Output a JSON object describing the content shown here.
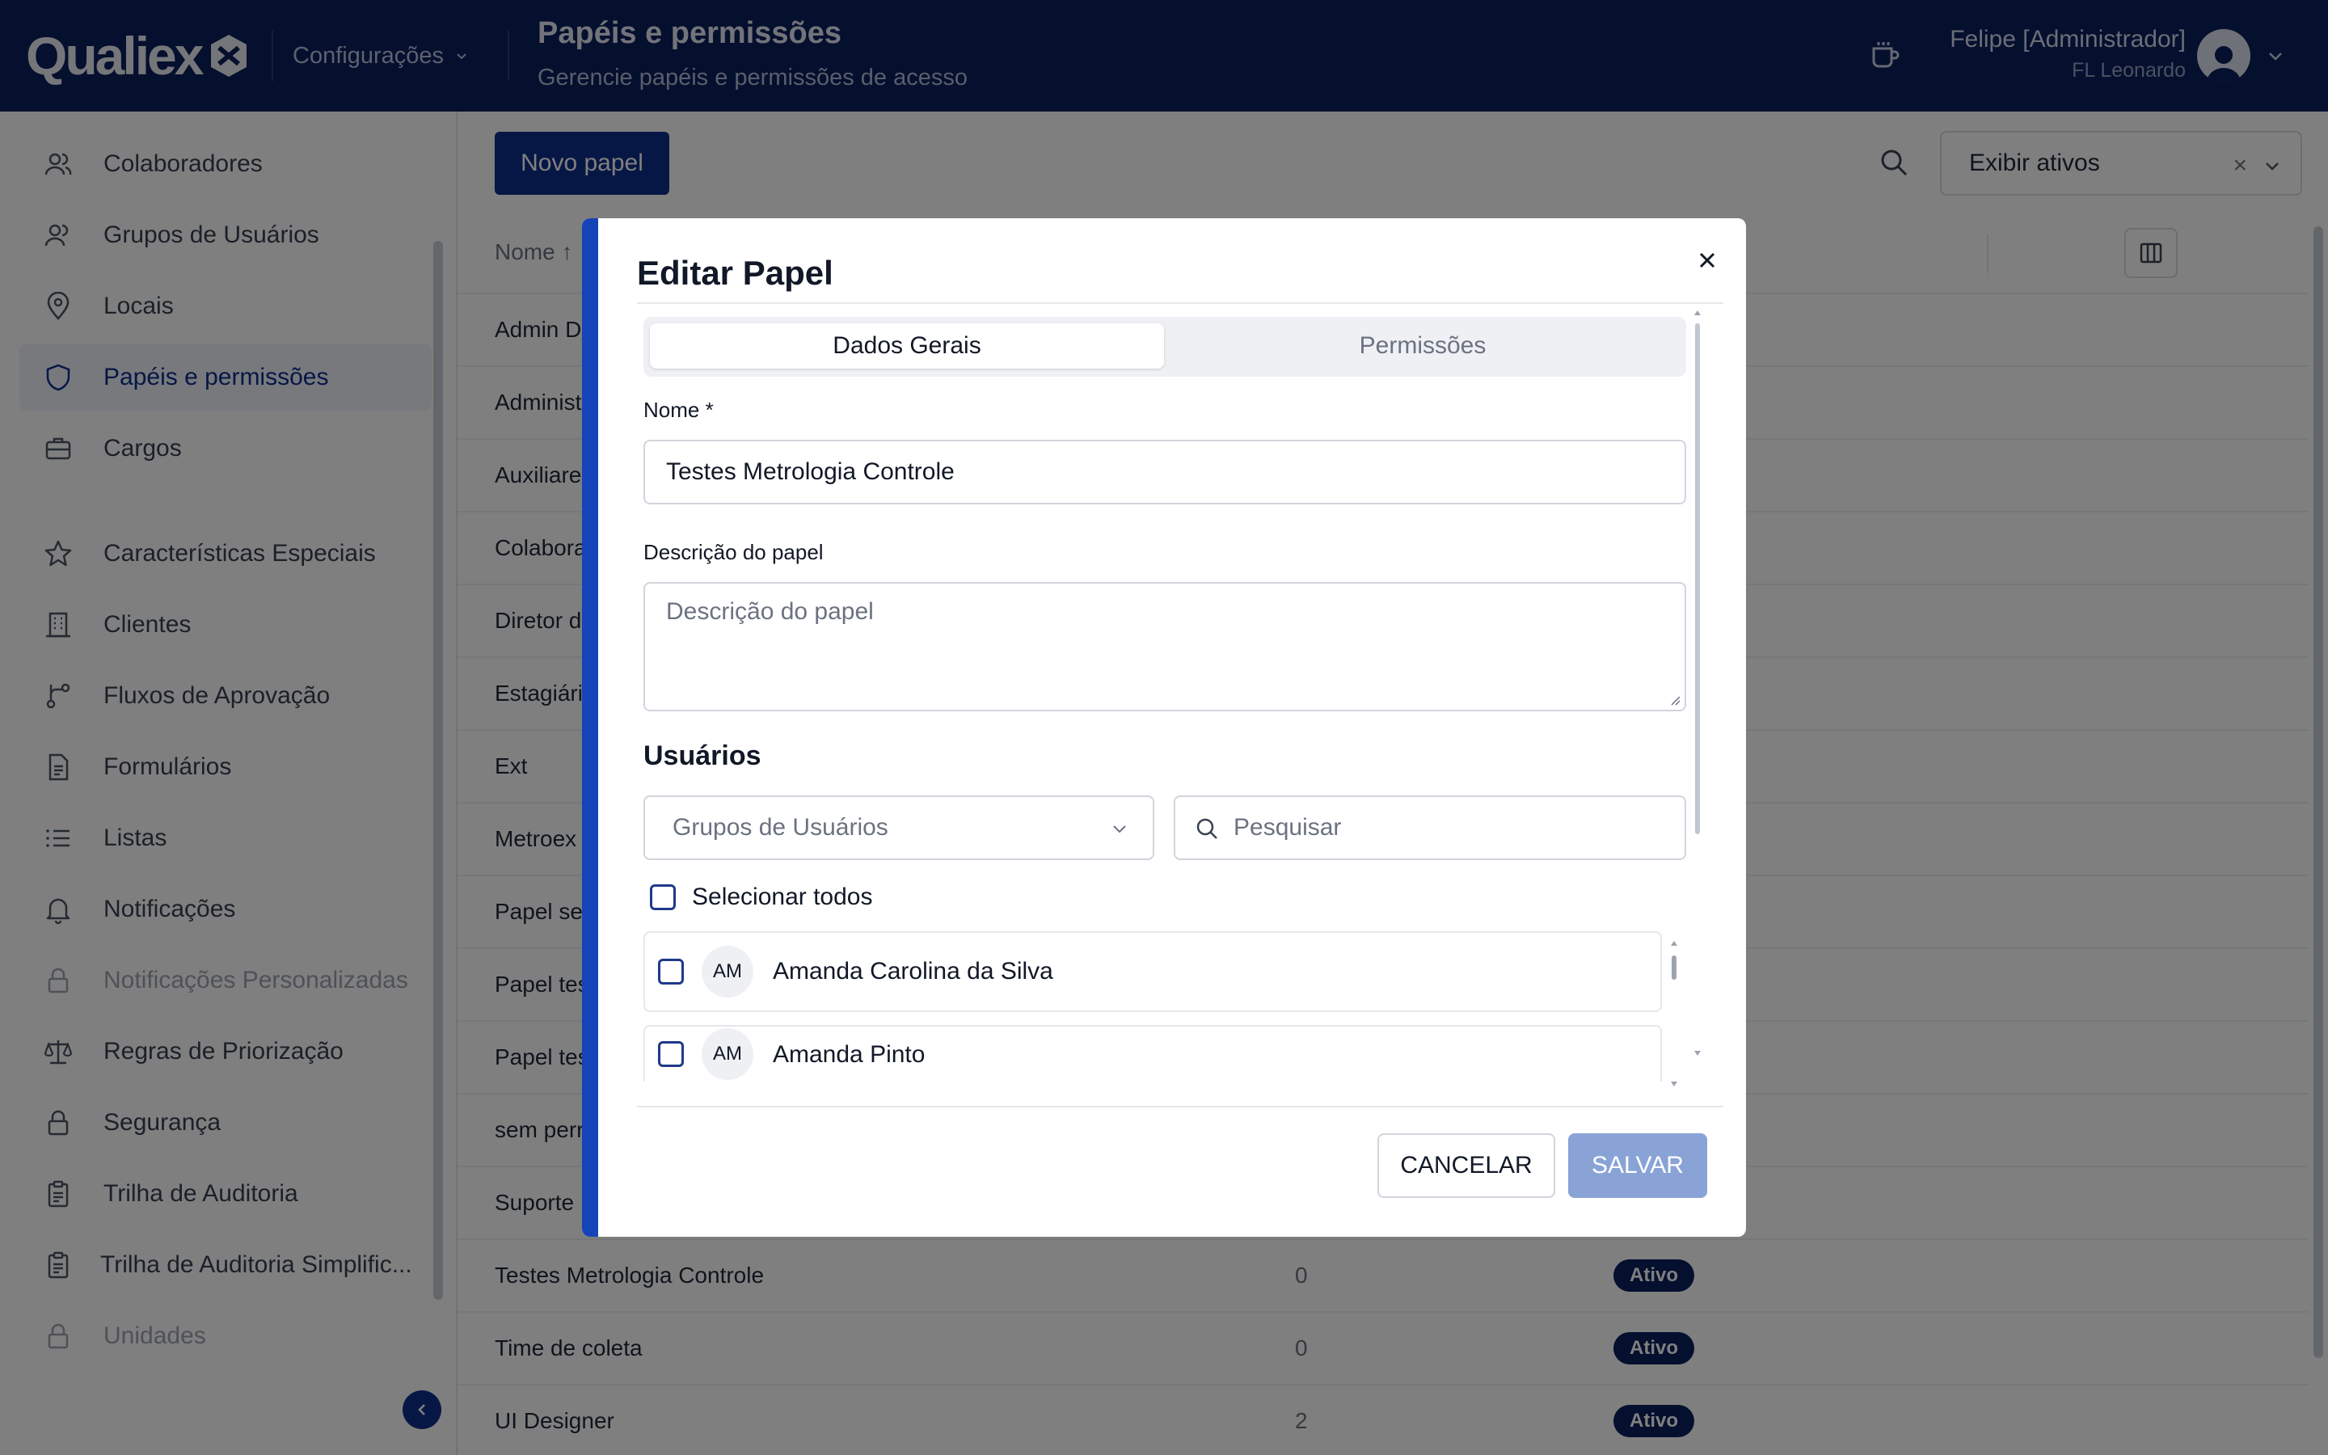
{
  "header": {
    "brand": "Qualiex",
    "module": "Configurações",
    "title": "Papéis e permissões",
    "subtitle": "Gerencie papéis e permissões de acesso",
    "user_name": "Felipe [Administrador]",
    "user_org": "FL Leonardo",
    "icons": [
      "coffee-cup-icon",
      "avatar-icon",
      "chevron-down-icon"
    ]
  },
  "sidebar": {
    "items": [
      {
        "label": "Colaboradores",
        "icon": "users-icon"
      },
      {
        "label": "Grupos de Usuários",
        "icon": "user-group-icon"
      },
      {
        "label": "Locais",
        "icon": "map-pin-icon"
      },
      {
        "label": "Papéis e permissões",
        "icon": "shield-icon",
        "active": true
      },
      {
        "label": "Cargos",
        "icon": "briefcase-icon"
      },
      {
        "label": "Características Especiais",
        "icon": "star-icon"
      },
      {
        "label": "Clientes",
        "icon": "building-icon"
      },
      {
        "label": "Fluxos de Aprovação",
        "icon": "flow-icon"
      },
      {
        "label": "Formulários",
        "icon": "document-icon"
      },
      {
        "label": "Listas",
        "icon": "list-icon"
      },
      {
        "label": "Notificações",
        "icon": "bell-icon"
      },
      {
        "label": "Notificações Personalizadas",
        "icon": "lock-icon",
        "disabled": true
      },
      {
        "label": "Regras de Priorização",
        "icon": "scale-icon"
      },
      {
        "label": "Segurança",
        "icon": "lock-icon"
      },
      {
        "label": "Trilha de Auditoria",
        "icon": "clipboard-icon"
      },
      {
        "label": "Trilha de Auditoria Simplific...",
        "icon": "clipboard-icon"
      },
      {
        "label": "Unidades",
        "icon": "lock-icon",
        "disabled": true
      }
    ]
  },
  "toolbar": {
    "new_button": "Novo papel",
    "filter_value": "Exibir ativos",
    "filter_clear": "×"
  },
  "table": {
    "header_name": "Nome ↑",
    "rows": [
      {
        "name": "Admin D",
        "count": "",
        "status": ""
      },
      {
        "name": "Administ",
        "count": "",
        "status": ""
      },
      {
        "name": "Auxiliare",
        "count": "",
        "status": ""
      },
      {
        "name": "Colabora",
        "count": "",
        "status": ""
      },
      {
        "name": "Diretor d",
        "count": "",
        "status": ""
      },
      {
        "name": "Estagiári",
        "count": "",
        "status": ""
      },
      {
        "name": "Ext",
        "count": "",
        "status": ""
      },
      {
        "name": "Metroex",
        "count": "",
        "status": ""
      },
      {
        "name": "Papel se",
        "count": "",
        "status": ""
      },
      {
        "name": "Papel tes",
        "count": "",
        "status": ""
      },
      {
        "name": "Papel tes",
        "count": "",
        "status": ""
      },
      {
        "name": "sem perr",
        "count": "",
        "status": ""
      },
      {
        "name": "Suporte",
        "count": "",
        "status": ""
      },
      {
        "name": "Testes Metrologia Controle",
        "count": "0",
        "status": "Ativo"
      },
      {
        "name": "Time de coleta",
        "count": "0",
        "status": "Ativo"
      },
      {
        "name": "UI Designer",
        "count": "2",
        "status": "Ativo"
      }
    ]
  },
  "modal": {
    "title": "Editar Papel",
    "tabs": [
      "Dados Gerais",
      "Permissões"
    ],
    "active_tab": "Dados Gerais",
    "name_label": "Nome *",
    "name_value": "Testes Metrologia Controle",
    "desc_label": "Descrição do papel",
    "desc_placeholder": "Descrição do papel",
    "users_title": "Usuários",
    "group_select_placeholder": "Grupos de Usuários",
    "search_placeholder": "Pesquisar",
    "select_all": "Selecionar todos",
    "users": [
      {
        "initials": "AM",
        "name": "Amanda Carolina da Silva",
        "checked": false
      },
      {
        "initials": "AM",
        "name": "Amanda Pinto",
        "checked": false
      }
    ],
    "cancel": "CANCELAR",
    "save": "SALVAR"
  },
  "colors": {
    "header_bg": "#0a1f5c",
    "primary": "#0f2f8a",
    "accent_stripe": "#1543b8",
    "save_disabled": "#8aa3d6"
  }
}
